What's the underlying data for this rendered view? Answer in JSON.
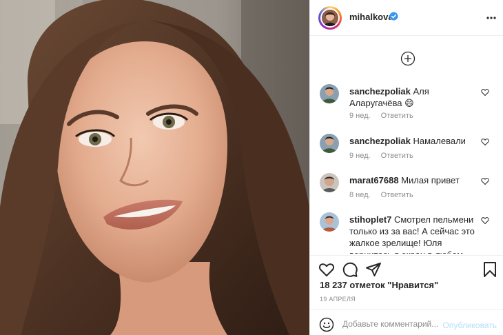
{
  "header": {
    "username": "mihalkova",
    "verified_icon": "verified-badge-icon",
    "more_icon": "more-options-icon"
  },
  "add_icon": "add-circle-icon",
  "comments": [
    {
      "user": "sanchezpoliak",
      "text": "Аля Аларугачёва 😄",
      "age": "9 нед.",
      "reply": "Ответить"
    },
    {
      "user": "sanchezpoliak",
      "text": "Намалевали",
      "age": "9 нед.",
      "reply": "Ответить"
    },
    {
      "user": "marat67688",
      "text": "Милая привет",
      "age": "8 нед.",
      "reply": "Ответить"
    },
    {
      "user": "stihoplet7",
      "text": "Смотрел пельмени только из за вас! А сейчас это жалкое зрелище! Юля вернитесь в экран в любом",
      "age": "",
      "reply": ""
    }
  ],
  "actions": {
    "like_icon": "heart-icon",
    "comment_icon": "comment-icon",
    "share_icon": "share-icon",
    "save_icon": "bookmark-icon"
  },
  "likes_text": "18 237 отметок \"Нравится\"",
  "date_text": "19 АПРЕЛЯ",
  "add_comment": {
    "placeholder": "Добавьте комментарий...",
    "publish_label": "Опубликовать"
  },
  "colors": {
    "link_disabled": "#b2dffc",
    "meta_gray": "#8e8e8e",
    "verified_blue": "#3897f0",
    "text": "#262626"
  }
}
